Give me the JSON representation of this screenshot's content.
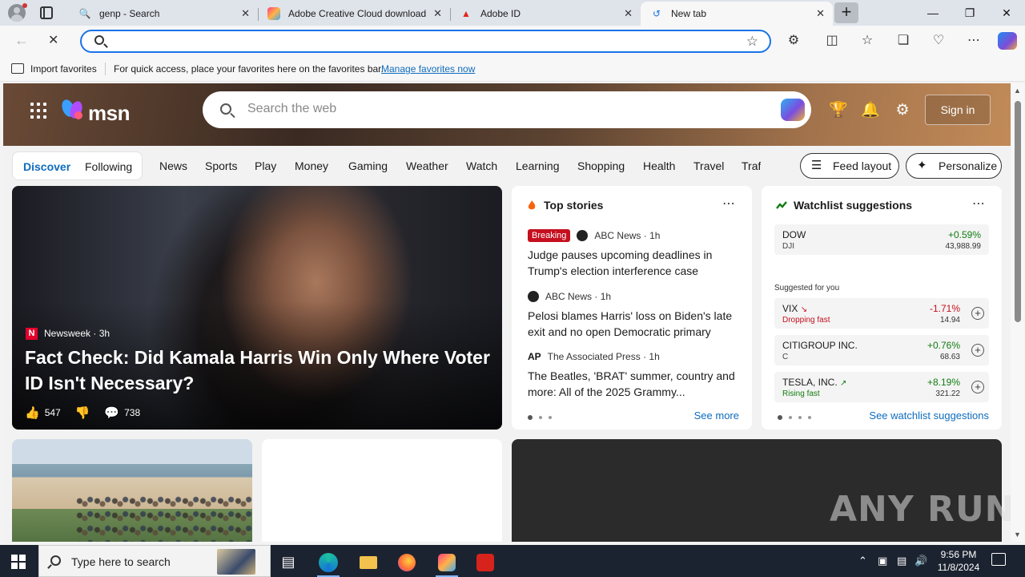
{
  "browser": {
    "tabs": [
      {
        "label": "genp - Search",
        "icon": "search-icon"
      },
      {
        "label": "Adobe Creative Cloud download",
        "icon": "creative-cloud-icon"
      },
      {
        "label": "Adobe ID",
        "icon": "adobe-icon"
      },
      {
        "label": "New tab",
        "icon": "loading-icon",
        "active": true
      }
    ],
    "address_value": "",
    "favorites": {
      "import_label": "Import favorites",
      "hint": "For quick access, place your favorites here on the favorites bar.",
      "manage_link": "Manage favorites now"
    }
  },
  "msn": {
    "logo_text": "msn",
    "search_placeholder": "Search the web",
    "signin_label": "Sign in",
    "feed_tabs": {
      "discover": "Discover",
      "following": "Following"
    },
    "nav": [
      "News",
      "Sports",
      "Play",
      "Money",
      "Gaming",
      "Weather",
      "Watch",
      "Learning",
      "Shopping",
      "Health",
      "Travel",
      "Traf"
    ],
    "feed_layout_label": "Feed layout",
    "personalize_label": "Personalize",
    "hero": {
      "source_logo": "N",
      "source": "Newsweek",
      "age": "3h",
      "title": "Fact Check: Did Kamala Harris Win Only Where Voter ID Isn't Necessary?",
      "likes": "547",
      "comments": "738"
    },
    "top_stories": {
      "heading": "Top stories",
      "badge": "Breaking",
      "items": [
        {
          "source": "ABC News",
          "age": "1h",
          "title": "Judge pauses upcoming deadlines in Trump's election interference case"
        },
        {
          "source": "ABC News",
          "age": "1h",
          "title": "Pelosi blames Harris' loss on Biden's late exit and no open Democratic primary"
        },
        {
          "source_logo": "AP",
          "source": "The Associated Press",
          "age": "1h",
          "title": "The Beatles, 'BRAT' summer, country and more: All of the 2025 Grammy..."
        }
      ],
      "see_more": "See more"
    },
    "watchlist": {
      "heading": "Watchlist suggestions",
      "suggested_label": "Suggested for you",
      "quotes": [
        {
          "name": "DOW",
          "sub": "DJI",
          "change": "+0.59%",
          "price": "43,988.99"
        },
        {
          "name": "VIX",
          "sub": "Dropping fast",
          "change": "-1.71%",
          "price": "14.94"
        },
        {
          "name": "CITIGROUP INC.",
          "sub": "C",
          "change": "+0.76%",
          "price": "68.63"
        },
        {
          "name": "TESLA, INC.",
          "sub": "Rising fast",
          "change": "+8.19%",
          "price": "321.22"
        }
      ],
      "see_link": "See watchlist suggestions"
    }
  },
  "watermark": "ANY RUN",
  "taskbar": {
    "search_placeholder": "Type here to search",
    "time": "9:56 PM",
    "date": "11/8/2024"
  },
  "colors": {
    "accent": "#0f6cbd",
    "up": "#107c10",
    "down": "#c50f1f",
    "breaking": "#c50f1f"
  }
}
